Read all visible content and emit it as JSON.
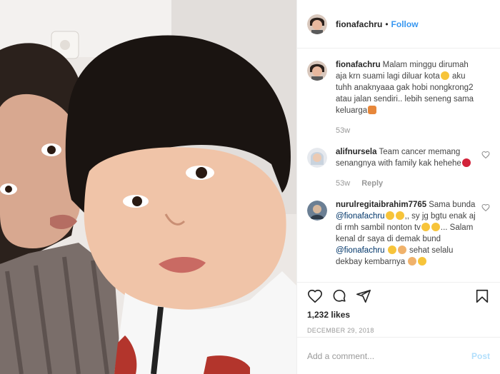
{
  "header": {
    "username": "fionafachru",
    "separator": "•",
    "follow_label": "Follow"
  },
  "caption": {
    "username": "fionafachru",
    "text": "Malam minggu dirumah aja krn suami lagi diluar kota",
    "text2": " aku tuhh anaknyaaa gak hobi nongkrong2 atau jalan sendiri.. lebih seneng sama keluarga",
    "time": "53w"
  },
  "comments": [
    {
      "username": "alifnursela",
      "text": "Team cancer memang senangnya with family kak hehehe",
      "time": "53w",
      "reply_label": "Reply"
    },
    {
      "username": "nurulregitaibrahim7765",
      "text_a": "Sama bunda",
      "mention_a": "@fionafachru",
      "text_b": ",, sy jg bgtu enak aj di rmh sambil nonton tv",
      "text_c": "... Salam kenal dr saya di demak bund",
      "mention_b": "@fionafachru",
      "text_d": " sehat selalu dekbay kembarnya"
    }
  ],
  "likes": "1,232 likes",
  "date": "December 29, 2018",
  "add_comment": {
    "placeholder": "Add a comment...",
    "post_label": "Post"
  },
  "icons": {
    "like": "heart-icon",
    "comment": "comment-icon",
    "share": "share-icon",
    "save": "bookmark-icon"
  },
  "colors": {
    "accent": "#3897f0",
    "post_disabled": "#b2dffc",
    "muted": "#999999"
  }
}
